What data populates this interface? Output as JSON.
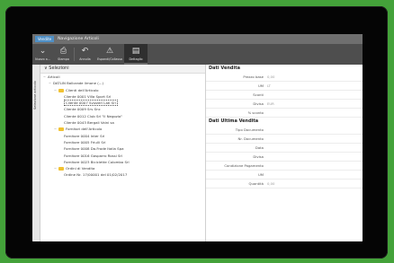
{
  "app": {
    "button_label": "Vendite",
    "window_title": "Navigazione Articoli"
  },
  "toolbar": {
    "items": [
      {
        "label": "Nuovo a...",
        "icon": "chevron-down-icon"
      },
      {
        "label": "Stampa",
        "icon": "printer-icon"
      },
      {
        "label": "Annulla",
        "icon": "undo-icon"
      },
      {
        "label": "Espandi/Collassa",
        "icon": "warning-icon"
      },
      {
        "label": "Dettaglio",
        "icon": "detail-icon"
      }
    ]
  },
  "sidebar": {
    "vertical_label": "Selezione articolo"
  },
  "left_pane": {
    "header": "Selezioni",
    "tree": [
      {
        "label": "Articoli",
        "level": 0,
        "toggle": "−",
        "folder": false
      },
      {
        "label": "DATLIN Ballorade limone (...)",
        "level": 1,
        "toggle": "−",
        "folder": false
      },
      {
        "label": "Clienti dell'Articolo",
        "level": 2,
        "toggle": "−",
        "folder": true
      },
      {
        "label": "Cliente 0001 Villa Sport Srl",
        "level": 3,
        "toggle": "",
        "folder": false
      },
      {
        "label": "Cliente 0007 Svizzeri Lati Srl",
        "level": 3,
        "toggle": "",
        "folder": false,
        "selected": true
      },
      {
        "label": "Cliente 0009 Srv Snc",
        "level": 3,
        "toggle": "",
        "folder": false
      },
      {
        "label": "Cliente 0012 Club Srl \"Il Negozio\"",
        "level": 3,
        "toggle": "",
        "folder": false
      },
      {
        "label": "Cliente 0043 Bergali Vaini sa",
        "level": 3,
        "toggle": "",
        "folder": false
      },
      {
        "label": "Fornitori dell'Articolo",
        "level": 2,
        "toggle": "−",
        "folder": true
      },
      {
        "label": "Fornitore 0004 Inter Srl",
        "level": 3,
        "toggle": "",
        "folder": false
      },
      {
        "label": "Fornitore 0005 Friulli Srl",
        "level": 3,
        "toggle": "",
        "folder": false
      },
      {
        "label": "Fornitore 0008 Da.Frode Italia Spa",
        "level": 3,
        "toggle": "",
        "folder": false
      },
      {
        "label": "Fornitore 0016 Gasparro Rossi Srl",
        "level": 3,
        "toggle": "",
        "folder": false
      },
      {
        "label": "Fornitore 0023 Biciclette Colombo Srl",
        "level": 3,
        "toggle": "",
        "folder": false
      },
      {
        "label": "Ordini di Vendita",
        "level": 2,
        "toggle": "−",
        "folder": true
      },
      {
        "label": "Ordine Nr. 17/00001 del 01/02/2017",
        "level": 3,
        "toggle": "",
        "folder": false
      }
    ]
  },
  "dati_vendita": {
    "title": "Dati Vendita",
    "fields": [
      {
        "label": "Prezzo base",
        "value": "0,00"
      },
      {
        "label": "UM",
        "value": "LT"
      },
      {
        "label": "Sconti",
        "value": ""
      },
      {
        "label": "Divisa",
        "value": "EUR"
      },
      {
        "label": "% sconto",
        "value": ""
      }
    ]
  },
  "dati_ultima_vendita": {
    "title": "Dati Ultima Vendita",
    "fields": [
      {
        "label": "Tipo Documento",
        "value": ""
      },
      {
        "label": "Nr. Documento",
        "value": ""
      },
      {
        "label": "Data",
        "value": ""
      },
      {
        "label": "Divisa",
        "value": ""
      },
      {
        "label": "Condizione Pagamento",
        "value": ""
      },
      {
        "label": "UM",
        "value": ""
      },
      {
        "label": "Quantità",
        "value": "0,00"
      }
    ]
  },
  "colors": {
    "background": "#44a23a",
    "titlebar": "#6f6f6f",
    "toolbar": "#4e4e4e",
    "app_button": "#4f8fc5",
    "folder": "#f1c232"
  }
}
